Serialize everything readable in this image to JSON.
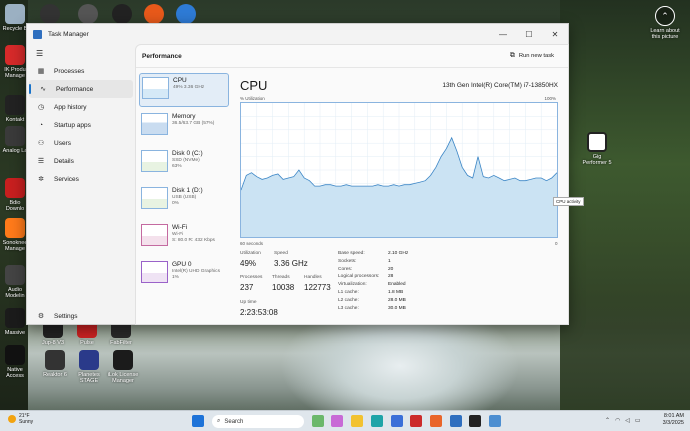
{
  "desktop": {
    "left_icons": [
      {
        "label": "Recycle B",
        "color": "#9bb0c2"
      },
      {
        "label": "IK Produ Manage",
        "color": "#d62a2a"
      },
      {
        "label": "Kontakt",
        "color": "#222222"
      },
      {
        "label": "Analog La",
        "color": "#3a3a3a"
      },
      {
        "label": "Bdio Downlo",
        "color": "#c81f1f"
      },
      {
        "label": "Sonoknee Manage",
        "color": "#ff7a1a"
      },
      {
        "label": "Audio Modelin",
        "color": "#444444"
      },
      {
        "label": "Massive",
        "color": "#1b1b1b"
      },
      {
        "label": "Native Access",
        "color": "#111111"
      }
    ],
    "bottom_icons": [
      {
        "label": "Jup-8 V3",
        "color": "#222222"
      },
      {
        "label": "Pulse",
        "color": "#cc2222"
      },
      {
        "label": "FabFilter",
        "color": "#2a2a2a"
      },
      {
        "label": "Reaktor 6",
        "color": "#333333"
      },
      {
        "label": "Planetes STAGE",
        "color": "#2a3a8a"
      },
      {
        "label": "iLok License Manager",
        "color": "#1b1b1b"
      }
    ],
    "top_icons": [
      {
        "color": "#333333"
      },
      {
        "color": "#555555"
      },
      {
        "color": "#222222"
      },
      {
        "color": "#e8591a"
      },
      {
        "color": "#2e7bd6"
      }
    ],
    "right_icons": [
      {
        "label": "Learn about this picture"
      },
      {
        "label": "Gig Performer 5"
      }
    ]
  },
  "window": {
    "title": "Task Manager",
    "controls": {
      "minimize": "—",
      "maximize": "☐",
      "close": "✕"
    }
  },
  "nav": {
    "items": [
      {
        "label": "Processes",
        "icon": "grid-icon",
        "glyph": "▦"
      },
      {
        "label": "Performance",
        "icon": "performance-icon",
        "glyph": "∿"
      },
      {
        "label": "App history",
        "icon": "history-icon",
        "glyph": "◷"
      },
      {
        "label": "Startup apps",
        "icon": "speedometer-icon",
        "glyph": "◔"
      },
      {
        "label": "Users",
        "icon": "users-icon",
        "glyph": "⚇"
      },
      {
        "label": "Details",
        "icon": "details-icon",
        "glyph": "☰"
      },
      {
        "label": "Services",
        "icon": "services-icon",
        "glyph": "✲"
      }
    ],
    "settings_label": "Settings"
  },
  "performance": {
    "header": "Performance",
    "run_new_task": "Run new task",
    "devices": [
      {
        "name": "CPU",
        "sub1": "49% 3.36 GHz",
        "sub2": ""
      },
      {
        "name": "Memory",
        "sub1": "36.5/63.7 GB (57%)",
        "sub2": ""
      },
      {
        "name": "Disk 0 (C:)",
        "sub1": "SSD (NVMe)",
        "sub2": "63%"
      },
      {
        "name": "Disk 1 (D:)",
        "sub1": "USB (USB)",
        "sub2": "0%"
      },
      {
        "name": "Wi-Fi",
        "sub1": "Wi-Fi",
        "sub2": "S: 80.0 R: 432 Kbps"
      },
      {
        "name": "GPU 0",
        "sub1": "Intel(R) UHD Graphics",
        "sub2": "1%"
      }
    ],
    "cpu": {
      "title": "CPU",
      "model": "13th Gen Intel(R) Core(TM) i7-13850HX",
      "axis_left": "% Utilization",
      "axis_right": "100%",
      "time_left": "60 seconds",
      "time_right": "0",
      "tooltip": "CPU activity",
      "stats": {
        "utilization_label": "Utilization",
        "utilization": "49%",
        "speed_label": "Speed",
        "speed": "3.36 GHz",
        "processes_label": "Processes",
        "processes": "237",
        "threads_label": "Threads",
        "threads": "10038",
        "handles_label": "Handles",
        "handles": "122773",
        "uptime_label": "Up time",
        "uptime": "2:23:53:08"
      },
      "specs": [
        {
          "k": "Base speed:",
          "v": "2.10 GHz"
        },
        {
          "k": "Sockets:",
          "v": "1"
        },
        {
          "k": "Cores:",
          "v": "20"
        },
        {
          "k": "Logical processors:",
          "v": "28"
        },
        {
          "k": "Virtualization:",
          "v": "Enabled"
        },
        {
          "k": "L1 cache:",
          "v": "1.8 MB"
        },
        {
          "k": "L2 cache:",
          "v": "28.0 MB"
        },
        {
          "k": "L3 cache:",
          "v": "30.0 MB"
        }
      ]
    }
  },
  "chart_data": {
    "type": "area",
    "title": "",
    "xlabel": "",
    "ylabel": "% Utilization",
    "xlim": [
      60,
      0
    ],
    "ylim": [
      0,
      100
    ],
    "x": [
      60,
      59,
      58,
      57,
      56,
      55,
      54,
      53,
      52,
      51,
      50,
      49,
      48,
      47,
      46,
      45,
      44,
      43,
      42,
      41,
      40,
      39,
      38,
      37,
      36,
      35,
      34,
      33,
      32,
      31,
      30,
      29,
      28,
      27,
      26,
      25,
      24,
      23,
      22,
      21,
      20,
      19,
      18,
      17,
      16,
      15,
      14,
      13,
      12,
      11,
      10,
      9,
      8,
      7,
      6,
      5,
      4,
      3,
      2,
      1,
      0
    ],
    "series": [
      {
        "values": [
          35,
          46,
          48,
          45,
          43,
          44,
          46,
          47,
          43,
          44,
          45,
          50,
          44,
          42,
          38,
          38,
          39,
          39,
          38,
          38,
          39,
          38,
          38,
          38,
          38,
          38,
          39,
          38,
          38,
          39,
          38,
          39,
          39,
          40,
          41,
          42,
          46,
          52,
          60,
          66,
          74,
          64,
          52,
          46,
          44,
          60,
          45,
          44,
          46,
          44,
          42,
          43,
          44,
          42,
          42,
          43,
          44,
          44,
          42,
          44,
          48
        ]
      }
    ],
    "color": "#cbe3f3",
    "line_color": "#3c86c6"
  },
  "taskbar": {
    "weather_temp": "21°F",
    "weather_desc": "Sunny",
    "search_placeholder": "Search",
    "time": "8:01 AM",
    "date": "3/3/2025"
  }
}
